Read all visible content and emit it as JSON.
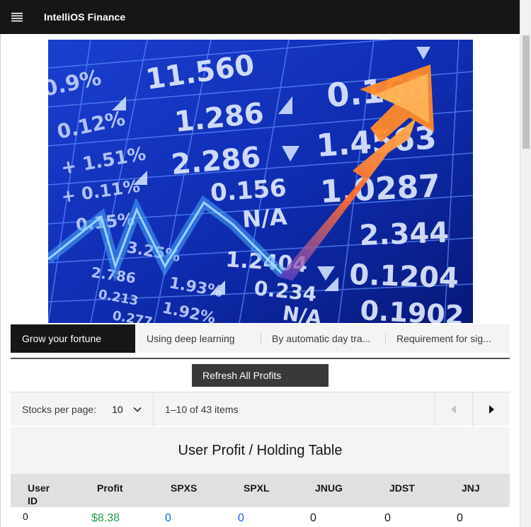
{
  "header": {
    "brand": "IntelliOS Finance",
    "menu_icon": "hamburger-menu-icon"
  },
  "hero": {
    "numbers_right": [
      "11.560",
      "0.168",
      "1.286",
      "2.286",
      "1.4563",
      "0.156",
      "1.0287",
      "N/A",
      "2.344",
      "1.2404",
      "0.1204",
      "0.234",
      "0.1902",
      "N/A"
    ],
    "numbers_left": [
      "0.9%",
      "0.12%",
      "1.51%",
      "0.11%",
      "0.15%",
      "3.25%",
      "2.786",
      "1.93%",
      "1.92%",
      "0.213",
      "0.277"
    ],
    "colors": {
      "background": "#0b1e8a",
      "grid": "#5a8cff",
      "arrow": "#ff7a1a",
      "line": "#4aa8ff"
    }
  },
  "tabs": [
    {
      "label": "Grow your fortune",
      "selected": true
    },
    {
      "label": "Using deep learning",
      "selected": false
    },
    {
      "label": "By automatic day tra...",
      "selected": false
    },
    {
      "label": "Requirement for sig...",
      "selected": false
    }
  ],
  "actions": {
    "refresh_label": "Refresh All Profits"
  },
  "pagination": {
    "per_page_label": "Stocks per page:",
    "per_page_value": "10",
    "range_text": "1–10 of 43 items",
    "prev_icon": "caret-left-icon",
    "next_icon": "caret-right-icon"
  },
  "table": {
    "title": "User Profit / Holding Table",
    "headers": [
      "User ID",
      "Profit",
      "SPXS",
      "SPXL",
      "JNUG",
      "JDST",
      "JNJ"
    ],
    "rows": [
      [
        "0",
        "$8.38",
        "0",
        "0",
        "0",
        "0",
        "0"
      ]
    ],
    "colors": {
      "profit": "#24a148",
      "link": "#0f62fe"
    }
  }
}
